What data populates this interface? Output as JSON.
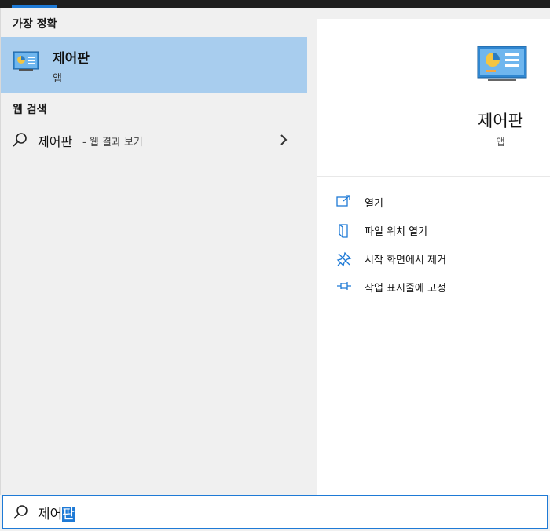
{
  "left": {
    "best_match_title": "가장 정확",
    "best_match": {
      "name": "제어판",
      "type": "앱"
    },
    "web_search_title": "웹 검색",
    "web_result": {
      "query": "제어판",
      "suffix": "- 웹 결과 보기"
    }
  },
  "right": {
    "app_name": "제어판",
    "app_type": "앱",
    "actions": [
      {
        "label": "열기",
        "icon": "open-icon"
      },
      {
        "label": "파일 위치 열기",
        "icon": "file-location-icon"
      },
      {
        "label": "시작 화면에서 제거",
        "icon": "unpin-start-icon"
      },
      {
        "label": "작업 표시줄에 고정",
        "icon": "pin-taskbar-icon"
      }
    ]
  },
  "search": {
    "text_plain": "제어",
    "text_selected": "판"
  },
  "colors": {
    "accent": "#1e7ad6",
    "highlight": "#a8cdee",
    "panel": "#f0f0f0"
  }
}
